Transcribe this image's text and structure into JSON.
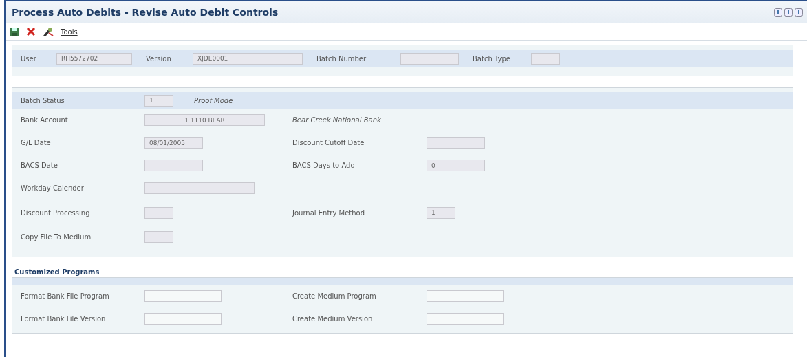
{
  "window": {
    "title": "Process Auto Debits - Revise Auto Debit Controls"
  },
  "toolbar": {
    "tools_label": "Tools"
  },
  "header_fields": [
    {
      "label": "User",
      "value": "RH5572702",
      "kind": "medium"
    },
    {
      "label": "Version",
      "value": "XJDE0001",
      "kind": "long"
    },
    {
      "label": "Batch Number",
      "kind": "small"
    },
    {
      "label": "Batch Type",
      "kind": "tiny"
    }
  ],
  "batch_status": {
    "label": "Batch Status",
    "value": "1",
    "description": "Proof Mode"
  },
  "bank_account": {
    "label": "Bank Account",
    "value": "1.1110 BEAR",
    "description": "Bear Creek National Bank"
  },
  "rows": [
    {
      "left": {
        "label": "G/L Date",
        "value": "08/01/2005",
        "kind": "small"
      },
      "right": {
        "label": "Discount Cutoff Date",
        "kind": "small"
      }
    },
    {
      "left": {
        "label": "BACS Date",
        "kind": "small"
      },
      "right": {
        "label": "BACS Days to Add",
        "value": "0",
        "kind": "small"
      }
    },
    {
      "left": {
        "label": "Workday Calender",
        "kind": "long"
      }
    },
    {
      "left": {
        "label": "Discount Processing",
        "kind": "tiny"
      },
      "right": {
        "label": "Journal Entry Method",
        "value": "1",
        "kind": "tiny"
      }
    },
    {
      "left": {
        "label": "Copy File To Medium",
        "kind": "tiny"
      }
    }
  ],
  "customized": {
    "title": "Customized Programs",
    "rows": [
      {
        "left": {
          "label": "Format Bank File Program"
        },
        "right": {
          "label": "Create Medium Program"
        }
      },
      {
        "left": {
          "label": "Format Bank File Version"
        },
        "right": {
          "label": "Create Medium Version"
        }
      }
    ]
  }
}
